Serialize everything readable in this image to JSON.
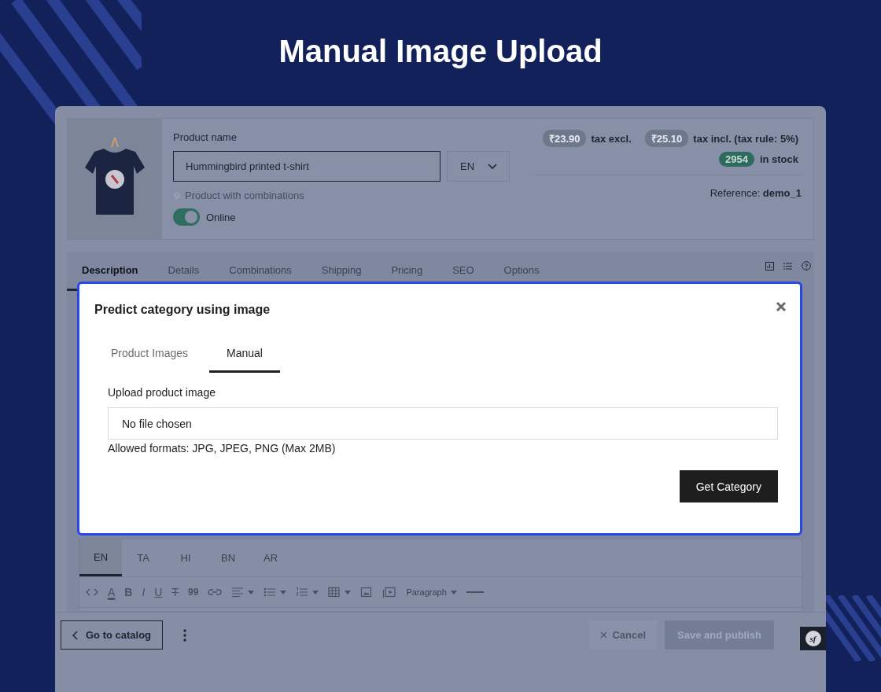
{
  "heading": "Manual Image Upload",
  "product": {
    "name_label": "Product name",
    "name_value": "Hummingbird printed t-shirt",
    "language": "EN",
    "combinations": "Product with combinations",
    "online": {
      "label": "Online",
      "on": true
    },
    "prices": [
      {
        "value": "₹23.90",
        "label": "tax excl."
      },
      {
        "value": "₹25.10",
        "label": "tax incl. (tax rule: 5%)"
      }
    ],
    "stock": {
      "value": "2954",
      "label": "in stock"
    },
    "reference": {
      "label": "Reference:",
      "value": "demo_1"
    }
  },
  "tabs": [
    {
      "label": "Description",
      "selected": true
    },
    {
      "label": "Details",
      "selected": false
    },
    {
      "label": "Combinations",
      "selected": false
    },
    {
      "label": "Shipping",
      "selected": false
    },
    {
      "label": "Pricing",
      "selected": false
    },
    {
      "label": "SEO",
      "selected": false
    },
    {
      "label": "Options",
      "selected": false
    }
  ],
  "modal": {
    "title": "Predict category using image",
    "tabs": [
      {
        "label": "Product Images",
        "selected": false
      },
      {
        "label": "Manual",
        "selected": true
      }
    ],
    "field_label": "Upload product image",
    "file_field": {
      "value": "No file chosen"
    },
    "hint": "Allowed formats: JPG, JPEG, PNG (Max 2MB)",
    "button": "Get Category"
  },
  "language_tabs": [
    {
      "label": "EN",
      "selected": true
    },
    {
      "label": "TA",
      "selected": false
    },
    {
      "label": "HI",
      "selected": false
    },
    {
      "label": "BN",
      "selected": false
    },
    {
      "label": "AR",
      "selected": false
    }
  ],
  "toolbar": [
    {
      "kind": "code",
      "dropdown": false
    },
    {
      "kind": "text-color",
      "label": "A",
      "dropdown": false
    },
    {
      "kind": "bold",
      "label": "B",
      "dropdown": false
    },
    {
      "kind": "italic",
      "label": "I",
      "dropdown": false
    },
    {
      "kind": "underline",
      "label": "U",
      "dropdown": false
    },
    {
      "kind": "strike",
      "label": "T",
      "dropdown": false
    },
    {
      "kind": "quote",
      "label": "99",
      "dropdown": false
    },
    {
      "kind": "link",
      "dropdown": false
    },
    {
      "kind": "align",
      "dropdown": true
    },
    {
      "kind": "bullets",
      "dropdown": true
    },
    {
      "kind": "numbers",
      "dropdown": true
    },
    {
      "kind": "table",
      "dropdown": true
    },
    {
      "kind": "image",
      "dropdown": false
    },
    {
      "kind": "video",
      "dropdown": false
    },
    {
      "kind": "select",
      "label": "Paragraph",
      "dropdown": true
    },
    {
      "kind": "rule",
      "dropdown": false
    }
  ],
  "footer": {
    "back": "Go to catalog",
    "cancel": {
      "label": "Cancel",
      "disabled": true
    },
    "save": {
      "label": "Save and publish",
      "disabled": true
    },
    "debug_badge": "sf"
  }
}
